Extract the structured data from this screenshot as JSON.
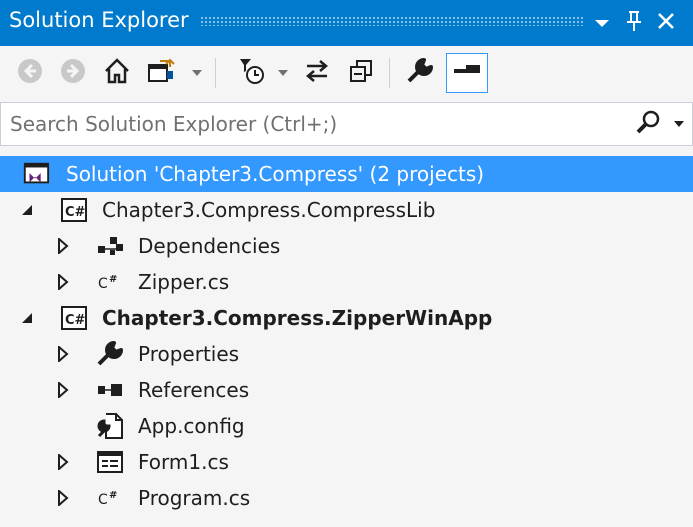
{
  "window": {
    "title": "Solution Explorer",
    "accent_color": "#007ACC",
    "selection_color": "#3399FF"
  },
  "title_buttons": [
    {
      "name": "window-position-menu",
      "icon": "chevron-down-icon"
    },
    {
      "name": "auto-hide-pin",
      "icon": "pin-icon"
    },
    {
      "name": "close",
      "icon": "close-icon"
    }
  ],
  "toolbar": {
    "buttons": [
      "back-icon",
      "forward-icon",
      "home-icon",
      "switch-views-icon",
      "pending-changes-filter-icon",
      "sync-with-active-document-icon",
      "collapse-all-icon",
      "properties-icon",
      "preview-selected-items-icon"
    ],
    "selected": "preview-selected-items-icon"
  },
  "search": {
    "placeholder": "Search Solution Explorer (Ctrl+;)",
    "value": ""
  },
  "tree": {
    "solution": {
      "label": "Solution 'Chapter3.Compress' (2 projects)",
      "icon": "solution-icon",
      "selected": true
    },
    "project1": {
      "label": "Chapter3.Compress.CompressLib",
      "icon": "csharp-project-icon",
      "expanded": true,
      "items": [
        {
          "label": "Dependencies",
          "icon": "dependencies-icon",
          "expandable": true
        },
        {
          "label": "Zipper.cs",
          "icon": "csharp-file-icon",
          "expandable": true
        }
      ]
    },
    "project2": {
      "label": "Chapter3.Compress.ZipperWinApp",
      "icon": "csharp-project-icon",
      "expanded": true,
      "bold": true,
      "items": [
        {
          "label": "Properties",
          "icon": "wrench-icon",
          "expandable": true
        },
        {
          "label": "References",
          "icon": "references-icon",
          "expandable": true
        },
        {
          "label": "App.config",
          "icon": "config-file-icon",
          "expandable": false
        },
        {
          "label": "Form1.cs",
          "icon": "form-icon",
          "expandable": true
        },
        {
          "label": "Program.cs",
          "icon": "csharp-file-icon",
          "expandable": true
        }
      ]
    }
  }
}
